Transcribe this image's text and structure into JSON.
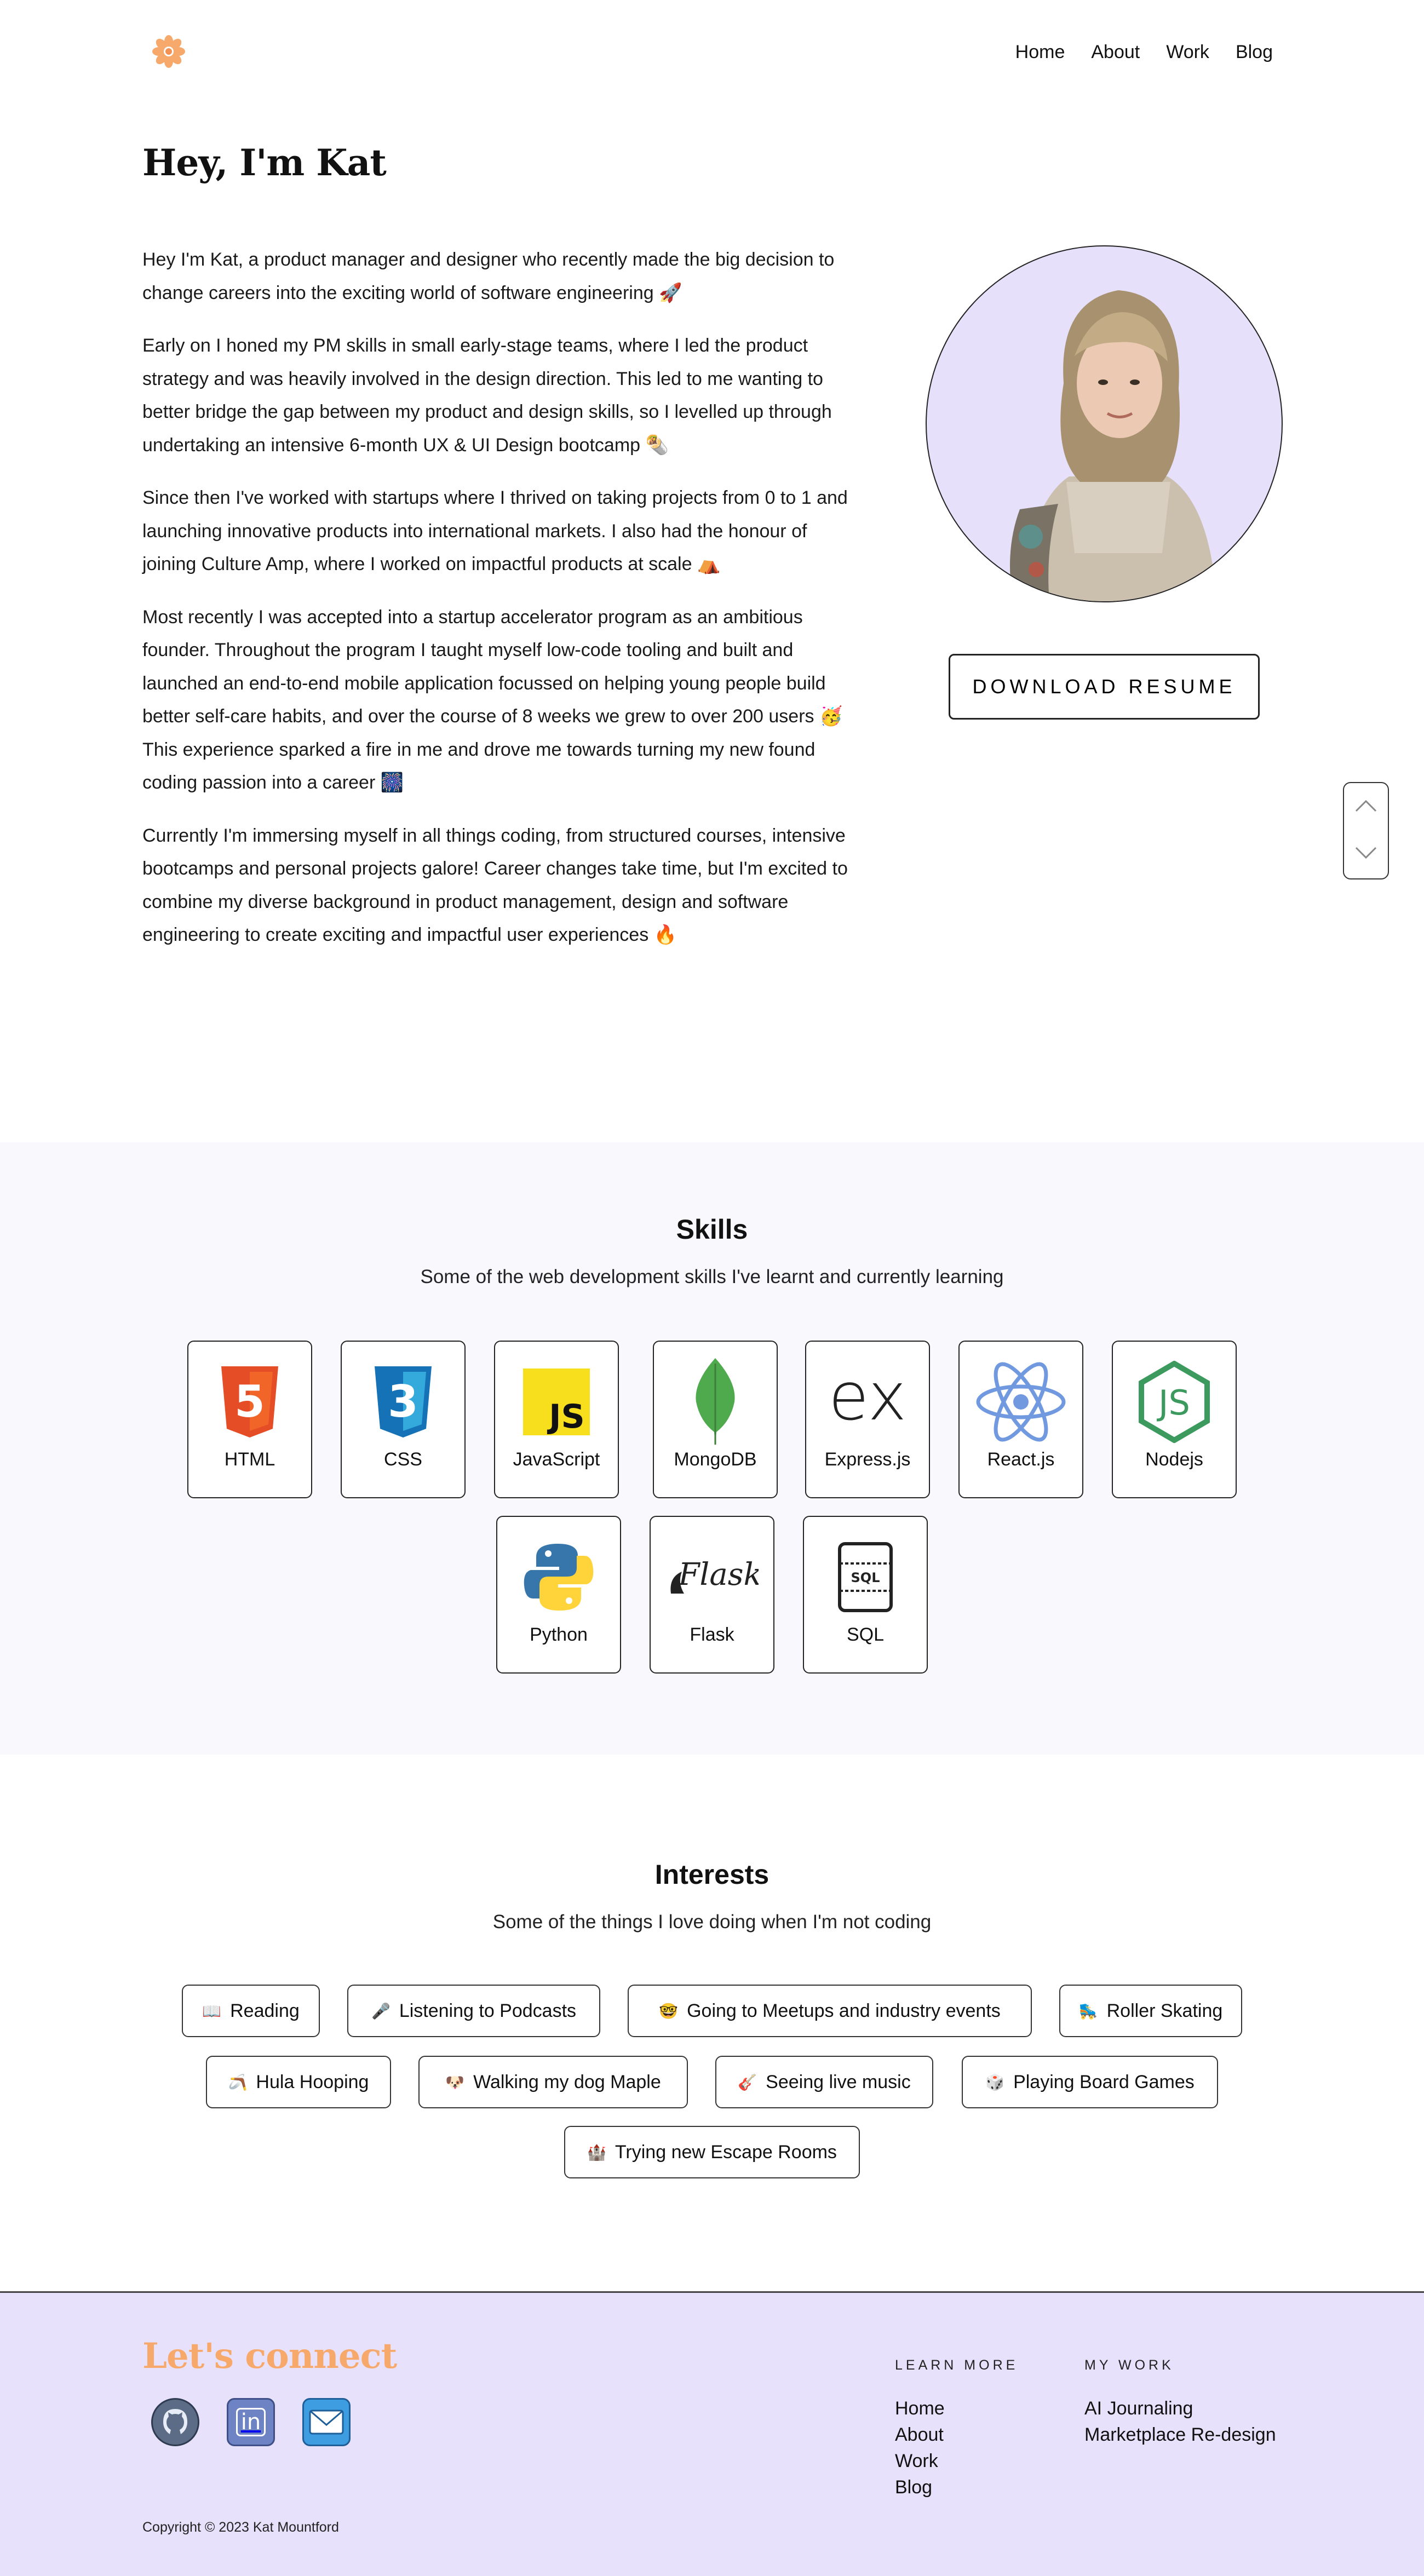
{
  "nav": {
    "items": [
      "Home",
      "About",
      "Work",
      "Blog"
    ]
  },
  "hero": {
    "title": "Hey, I'm Kat",
    "paragraphs": [
      "Hey I'm Kat, a product manager and designer who recently made the big decision to change careers into the exciting world of software engineering 🚀",
      "Early on I honed my PM skills in small early-stage teams, where I led the product strategy and was heavily involved in the design direction. This led to me wanting to better bridge the gap between my product and design skills, so I levelled up through undertaking an intensive 6-month UX & UI Design bootcamp 🌯",
      "Since then I've worked with startups where I thrived on taking projects from 0 to 1 and launching innovative products into international markets. I also had the honour of joining Culture Amp, where I worked on impactful products at scale ⛺",
      "Most recently I was accepted into a startup accelerator program as an ambitious founder. Throughout the program I taught myself low-code tooling and built and launched an end-to-end mobile application focussed on helping young people build better self-care habits, and over the course of 8 weeks we grew to over 200 users 🥳  This experience sparked a fire in me and drove me towards turning my new found coding passion into a career 🎆",
      "Currently I'm immersing myself in all things coding, from structured courses, intensive bootcamps and personal projects galore! Career changes take time, but I'm excited to combine my diverse background in product management, design and software engineering to create exciting and impactful user experiences 🔥"
    ],
    "resume_button": "DOWNLOAD RESUME"
  },
  "skills": {
    "title": "Skills",
    "subtitle": "Some of the web development skills I've learnt and currently learning",
    "items": [
      {
        "label": "HTML",
        "icon": "html5-icon"
      },
      {
        "label": "CSS",
        "icon": "css3-icon"
      },
      {
        "label": "JavaScript",
        "icon": "javascript-icon"
      },
      {
        "label": "MongoDB",
        "icon": "mongodb-icon"
      },
      {
        "label": "Express.js",
        "icon": "express-icon"
      },
      {
        "label": "React.js",
        "icon": "react-icon"
      },
      {
        "label": "Nodejs",
        "icon": "nodejs-icon"
      },
      {
        "label": "Python",
        "icon": "python-icon"
      },
      {
        "label": "Flask",
        "icon": "flask-icon"
      },
      {
        "label": "SQL",
        "icon": "sql-icon"
      }
    ],
    "icon_text": {
      "js": "JS",
      "ex": "ex",
      "flask": "Flask",
      "sql": "SQL",
      "html": "5",
      "css": "3"
    }
  },
  "interests": {
    "title": "Interests",
    "subtitle": "Some of the things I love doing when I'm not coding",
    "items": [
      {
        "emoji": "📖",
        "label": "Reading"
      },
      {
        "emoji": "🎤",
        "label": "Listening to Podcasts"
      },
      {
        "emoji": "🤓",
        "label": "Going to Meetups and industry events"
      },
      {
        "emoji": "🛼",
        "label": "Roller Skating"
      },
      {
        "emoji": "🪃",
        "label": "Hula Hooping"
      },
      {
        "emoji": "🐶",
        "label": "Walking my dog Maple"
      },
      {
        "emoji": "🎸",
        "label": "Seeing live music"
      },
      {
        "emoji": "🎲",
        "label": "Playing Board Games"
      },
      {
        "emoji": "🏰",
        "label": "Trying new Escape Rooms"
      }
    ]
  },
  "footer": {
    "connect_title": "Let's connect",
    "social": [
      {
        "icon": "github-icon",
        "text": ""
      },
      {
        "icon": "linkedin-icon",
        "text": "in"
      },
      {
        "icon": "email-icon",
        "text": ""
      }
    ],
    "copyright": "Copyright © 2023 Kat Mountford",
    "learn_more": {
      "heading": "LEARN MORE",
      "links": [
        "Home",
        "About",
        "Work",
        "Blog"
      ]
    },
    "my_work": {
      "heading": "MY WORK",
      "links": [
        "AI Journaling",
        "Marketplace Re-design"
      ]
    }
  },
  "colors": {
    "accent_orange": "#f7a96b",
    "footer_bg": "#e8e1fc",
    "portrait_bg": "#e6e0fa",
    "skills_bg": "#f8f8fd"
  }
}
